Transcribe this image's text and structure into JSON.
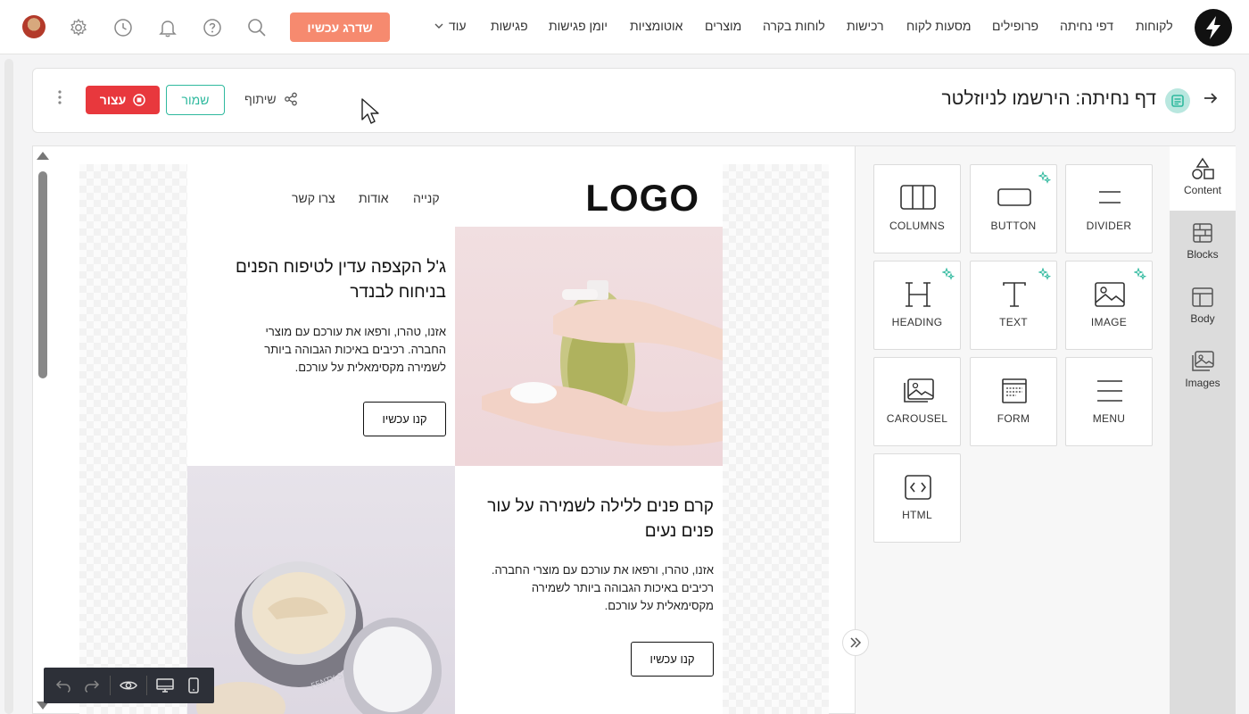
{
  "topnav": {
    "links": [
      "לקוחות",
      "דפי נחיתה",
      "פרופילים",
      "מסעות לקוח",
      "רכישות",
      "לוחות בקרה",
      "מוצרים",
      "אוטומציות",
      "יומן פגישות",
      "פגישות"
    ],
    "more_label": "עוד",
    "upgrade_label": "שדרג עכשיו"
  },
  "header": {
    "title": "דף נחיתה: הירשמו לניוזלטר",
    "share_label": "שיתוף",
    "save_label": "שמור",
    "stop_label": "עצור"
  },
  "email": {
    "logo": "LOGO",
    "nav": [
      "קנייה",
      "אודות",
      "צרו קשר"
    ],
    "blocks": [
      {
        "title": "ג'ל הקצפה עדין לטיפוח הפנים בניחוח לבנדר",
        "body": "אזנו, טהרו, ורפאו את עורכם עם מוצרי החברה. רכיבים באיכות הגבוהה ביותר לשמירה מקסימאלית על עורכם.",
        "button": "קנו עכשיו"
      },
      {
        "title": "קרם פנים ללילה לשמירה על עור פנים נעים",
        "body": "אזנו, טהרו, ורפאו את עורכם עם מוצרי החברה. רכיבים באיכות הגבוהה ביותר לשמירה מקסימאלית על עורכם.",
        "button": "קנו עכשיו"
      }
    ],
    "jar_label": "FENTY SKIN"
  },
  "tools": [
    {
      "label": "COLUMNS",
      "icon": "columns-icon",
      "ai": false
    },
    {
      "label": "BUTTON",
      "icon": "button-icon",
      "ai": true
    },
    {
      "label": "DIVIDER",
      "icon": "divider-icon",
      "ai": false
    },
    {
      "label": "HEADING",
      "icon": "heading-icon",
      "ai": true
    },
    {
      "label": "TEXT",
      "icon": "text-icon",
      "ai": true
    },
    {
      "label": "IMAGE",
      "icon": "image-icon",
      "ai": true
    },
    {
      "label": "CAROUSEL",
      "icon": "carousel-icon",
      "ai": false
    },
    {
      "label": "FORM",
      "icon": "form-icon",
      "ai": false
    },
    {
      "label": "MENU",
      "icon": "menu-icon",
      "ai": false
    },
    {
      "label": "HTML",
      "icon": "html-icon",
      "ai": false
    }
  ],
  "side_tabs": [
    {
      "label": "Content",
      "icon": "shapes-icon",
      "active": true
    },
    {
      "label": "Blocks",
      "icon": "bricks-icon",
      "active": false
    },
    {
      "label": "Body",
      "icon": "layout-icon",
      "active": false
    },
    {
      "label": "Images",
      "icon": "images-icon",
      "active": false
    }
  ],
  "colors": {
    "accent": "#2fb99e",
    "upgrade": "#f68a6f",
    "stop": "#e8383d",
    "ai_sparkle": "#2fb99e"
  }
}
